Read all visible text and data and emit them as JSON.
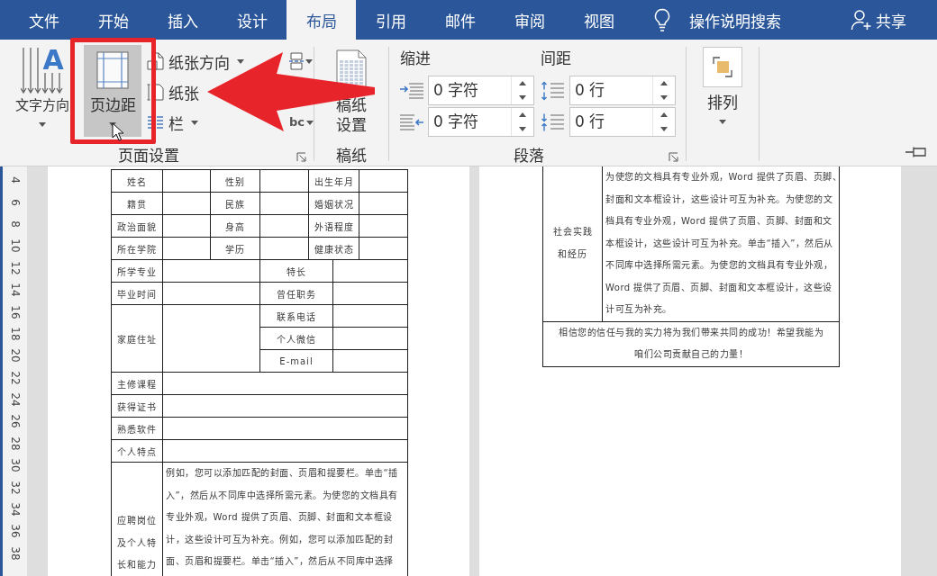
{
  "tabs": [
    {
      "label": "文件",
      "selected": false
    },
    {
      "label": "开始",
      "selected": false
    },
    {
      "label": "插入",
      "selected": false
    },
    {
      "label": "设计",
      "selected": false
    },
    {
      "label": "布局",
      "selected": true
    },
    {
      "label": "引用",
      "selected": false
    },
    {
      "label": "邮件",
      "selected": false
    },
    {
      "label": "审阅",
      "selected": false
    },
    {
      "label": "视图",
      "selected": false
    }
  ],
  "tell_me": {
    "label": "操作说明搜索"
  },
  "share": {
    "label": "共享"
  },
  "page_setup": {
    "title": "页面设置",
    "large_buttons": [
      {
        "kind": "text-direction",
        "label": "文字方向",
        "icon_letter": "A",
        "pressed": false
      },
      {
        "kind": "margins",
        "label": "页边距",
        "pressed": true
      }
    ],
    "small_buttons": [
      {
        "kind": "orientation",
        "label": "纸张方向",
        "dropdown": true
      },
      {
        "kind": "size",
        "label": "纸张",
        "dropdown": false
      },
      {
        "kind": "columns",
        "label": "栏",
        "dropdown": true
      }
    ],
    "side_buttons": [
      {
        "kind": "breaks"
      },
      {
        "kind": "hyphenation",
        "label": "bc"
      }
    ]
  },
  "manuscript": {
    "title": "稿纸",
    "button": "稿纸设置"
  },
  "paragraph": {
    "title": "段落",
    "indent": {
      "label": "缩进",
      "fields": [
        {
          "kind": "left",
          "value": "0 字符"
        },
        {
          "kind": "right",
          "value": "0 字符"
        }
      ]
    },
    "spacing": {
      "label": "间距",
      "fields": [
        {
          "kind": "before",
          "value": "0 行"
        },
        {
          "kind": "after",
          "value": "0 行"
        }
      ]
    }
  },
  "arrange": {
    "button": "排列"
  },
  "ruler": {
    "numbers": [
      "4",
      "6",
      "8",
      "10",
      "12",
      "14",
      "16",
      "18",
      "20",
      "22",
      "24",
      "26",
      "28",
      "30",
      "32",
      "34",
      "36",
      "38"
    ]
  },
  "page_1": {
    "continues_above": false,
    "continues_below": true,
    "rows": [
      {
        "kind": "three-pair",
        "labels": [
          "姓名",
          "性别",
          "出生年月"
        ]
      },
      {
        "kind": "three-pair",
        "labels": [
          "籍贯",
          "民族",
          "婚姻状况"
        ]
      },
      {
        "kind": "three-pair",
        "labels": [
          "政治面貌",
          "身高",
          "外语程度"
        ]
      },
      {
        "kind": "three-pair",
        "labels": [
          "所在学院",
          "学历",
          "健康状态"
        ]
      },
      {
        "kind": "two-pair",
        "labels": [
          "所学专业",
          "特长"
        ]
      },
      {
        "kind": "two-pair",
        "labels": [
          "毕业时间",
          "曾任职务"
        ]
      },
      {
        "kind": "contact-block",
        "label": "家庭住址",
        "sub_labels": [
          "联系电话",
          "个人微信",
          "E-mail"
        ]
      },
      {
        "kind": "wide",
        "label": "主修课程"
      },
      {
        "kind": "wide",
        "label": "获得证书"
      },
      {
        "kind": "wide",
        "label": "熟悉软件"
      },
      {
        "kind": "wide",
        "label": "个人特点"
      },
      {
        "kind": "text",
        "label": "应聘岗位及个人特长和能力",
        "text_lines": [
          "例如，您可以添加匹配的封面、页眉和提要栏。单击“插",
          "入”，然后从不同库中选择所需元素。为使您的文档具有",
          "专业外观，Word 提供了页眉、页脚、封面和文本框设",
          "计，这些设计可互为补充。例如，您可以添加匹配的封",
          "面、页眉和提要栏。单击“插入”，然后从不同库中选择"
        ]
      }
    ]
  },
  "page_2": {
    "continues_above": true,
    "continues_below": false,
    "rows": [
      {
        "kind": "text",
        "label": "社会实践和经历",
        "text_lines": [
          "为使您的文档具有专业外观，Word 提供了页眉、页脚、",
          "封面和文本框设计，这些设计可互为补充。为使您的文",
          "档具有专业外观，Word 提供了页眉、页脚、封面和文",
          "本框设计，这些设计可互为补充。单击“插入”，然后从",
          "不同库中选择所需元素。为使您的文档具有专业外观，",
          "Word 提供了页眉、页脚、封面和文本框设计，这些设",
          "计可互为补充。"
        ]
      },
      {
        "kind": "closing",
        "text_lines": [
          "相信您的信任与我的实力将为我们带来共同的成功！希望我能为",
          "咱们公司贡献自己的力量！"
        ]
      }
    ]
  },
  "overlays": [
    {
      "kind": "highlight-frame"
    },
    {
      "kind": "pointer-arrow"
    },
    {
      "kind": "mouse-cursor"
    }
  ]
}
